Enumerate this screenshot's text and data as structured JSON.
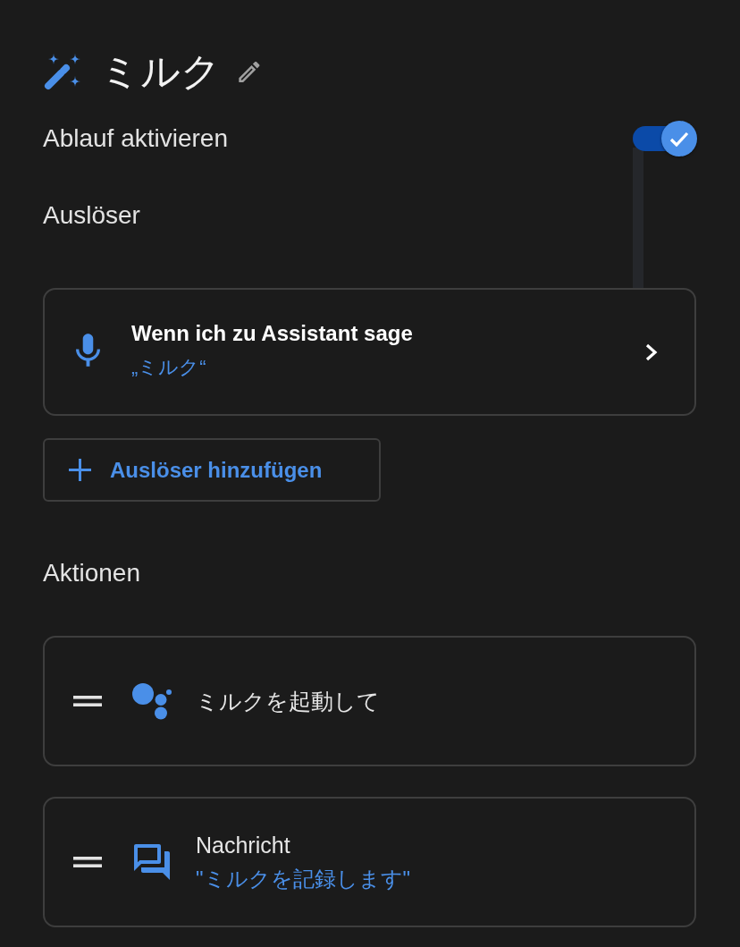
{
  "header": {
    "title": "ミルク"
  },
  "enable": {
    "label": "Ablauf aktivieren",
    "on": true
  },
  "triggers": {
    "heading": "Auslöser",
    "items": [
      {
        "kind": "voice",
        "title": "Wenn ich zu Assistant sage",
        "subtitle": "„ミルク“"
      }
    ],
    "add_button": "Auslöser hinzufügen"
  },
  "actions": {
    "heading": "Aktionen",
    "items": [
      {
        "kind": "assistant",
        "title": "ミルクを起動して"
      },
      {
        "kind": "message",
        "title": "Nachricht",
        "subtitle": "\"ミルクを記録します\""
      }
    ]
  }
}
